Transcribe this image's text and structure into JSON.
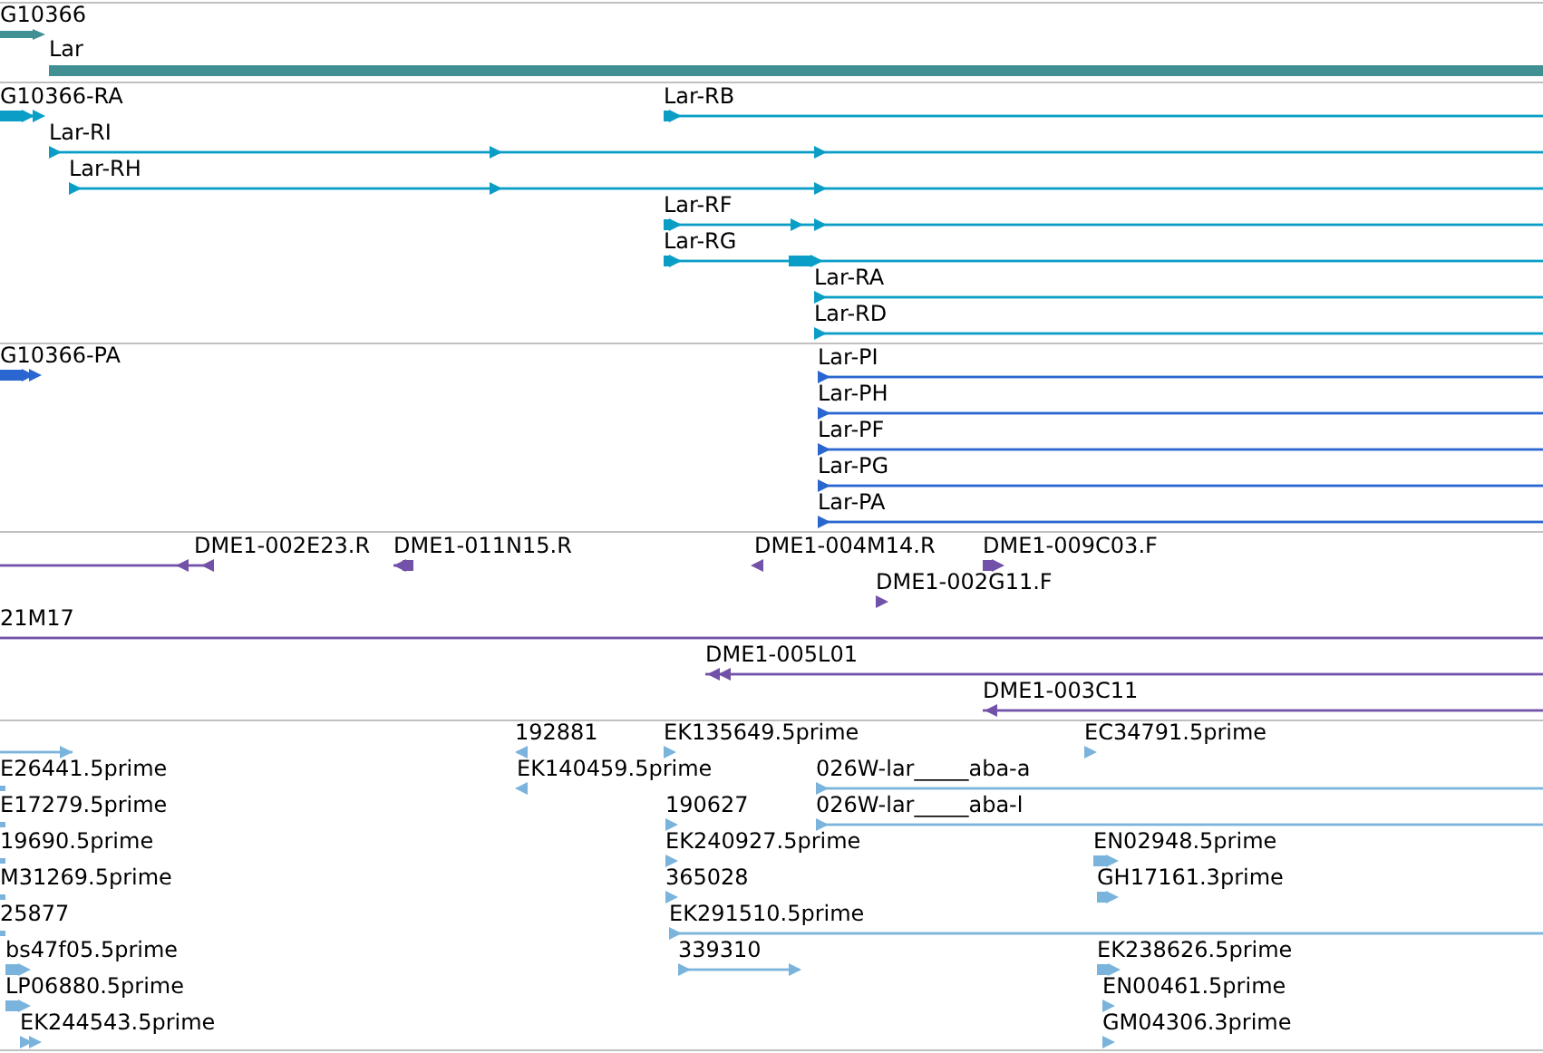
{
  "tracks": [
    {
      "color": "#3f8f93",
      "features": [
        {
          "label": "G10366",
          "reverse": false
        },
        {
          "label": "Lar"
        }
      ]
    },
    {
      "color": "#0a9ec6",
      "features": [
        {
          "label": "G10366-RA",
          "reverse": false
        },
        {
          "label": "Lar-RB",
          "reverse": false
        },
        {
          "label": "Lar-RI",
          "reverse": false
        },
        {
          "label": "Lar-RH",
          "reverse": false
        },
        {
          "label": "Lar-RF",
          "reverse": false
        },
        {
          "label": "Lar-RG",
          "reverse": false
        },
        {
          "label": "Lar-RA",
          "reverse": false
        },
        {
          "label": "Lar-RD",
          "reverse": false
        }
      ]
    },
    {
      "color": "#2a66d0",
      "features": [
        {
          "label": "G10366-PA",
          "reverse": false
        },
        {
          "label": "Lar-PI",
          "reverse": false
        },
        {
          "label": "Lar-PH",
          "reverse": false
        },
        {
          "label": "Lar-PF",
          "reverse": false
        },
        {
          "label": "Lar-PG",
          "reverse": false
        },
        {
          "label": "Lar-PA",
          "reverse": false
        }
      ]
    },
    {
      "color": "#7152a8",
      "features": [
        {
          "label": "DME1-002E23.R",
          "reverse": true
        },
        {
          "label": "DME1-011N15.R",
          "reverse": true
        },
        {
          "label": "DME1-004M14.R",
          "reverse": true
        },
        {
          "label": "DME1-009C03.F",
          "reverse": false
        },
        {
          "label": "DME1-002G11.F",
          "reverse": false
        },
        {
          "label": "21M17"
        },
        {
          "label": "DME1-005L01",
          "reverse": true
        },
        {
          "label": "DME1-003C11",
          "reverse": true
        }
      ]
    },
    {
      "color": "#7ab4dc",
      "features": [
        {
          "reverse": false
        },
        {
          "label": "E26441.5prime"
        },
        {
          "label": "E17279.5prime"
        },
        {
          "label": "19690.5prime"
        },
        {
          "label": "M31269.5prime"
        },
        {
          "label": "25877"
        },
        {
          "label": "bs47f05.5prime",
          "reverse": false
        },
        {
          "label": "LP06880.5prime",
          "reverse": false
        },
        {
          "label": "EK244543.5prime",
          "reverse": false
        },
        {
          "label": "192881",
          "reverse": true
        },
        {
          "label": "EK140459.5prime",
          "reverse": true
        },
        {
          "label": "EK135649.5prime",
          "reverse": false
        },
        {
          "label": "190627",
          "reverse": false
        },
        {
          "label": "EK240927.5prime",
          "reverse": false
        },
        {
          "label": "365028",
          "reverse": false
        },
        {
          "label": "EK291510.5prime",
          "reverse": false
        },
        {
          "label": "339310",
          "reverse": false
        },
        {
          "label": "026W-lar_____aba-a",
          "reverse": false
        },
        {
          "label": "026W-lar_____aba-l",
          "reverse": false
        },
        {
          "label": "EC34791.5prime",
          "reverse": false
        },
        {
          "label": "EN02948.5prime",
          "reverse": false
        },
        {
          "label": "GH17161.3prime",
          "reverse": false
        },
        {
          "label": "EK238626.5prime",
          "reverse": false
        },
        {
          "label": "EN00461.5prime",
          "reverse": false
        },
        {
          "label": "GM04306.3prime",
          "reverse": false
        }
      ]
    }
  ]
}
